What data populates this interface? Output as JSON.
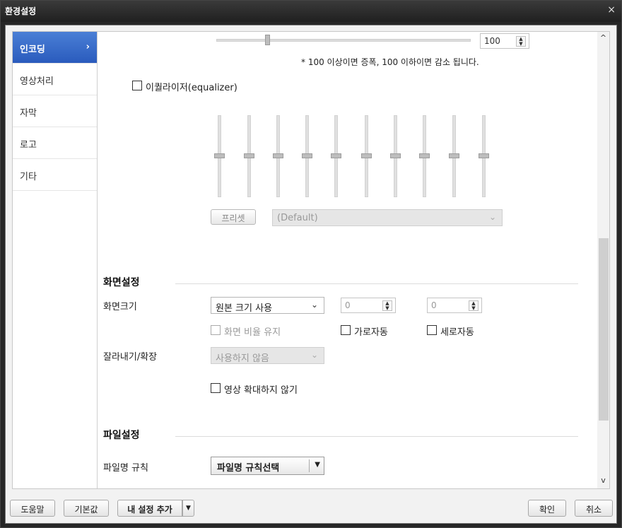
{
  "window": {
    "title": "환경설정",
    "close_icon": "×"
  },
  "sidebar": {
    "items": [
      {
        "label": "인코딩",
        "active": true
      },
      {
        "label": "영상처리"
      },
      {
        "label": "자막"
      },
      {
        "label": "로고"
      },
      {
        "label": "기타"
      }
    ],
    "active_chevron": "›"
  },
  "audio": {
    "volume_value": "100",
    "volume_slider_fraction": 0.2,
    "volume_note": "* 100 이상이면 증폭, 100 이하이면 감소 됩니다.",
    "equalizer_label": "이퀄라이저(equalizer)",
    "equalizer_checked": false,
    "equalizer_bands": 10,
    "preset_button": "프리셋",
    "preset_value": "(Default)"
  },
  "screen": {
    "section_title": "화면설정",
    "size_label": "화면크기",
    "size_value": "원본 크기 사용",
    "width_value": "0",
    "height_value": "0",
    "keep_ratio_label": "화면 비율 유지",
    "auto_width_label": "가로자동",
    "auto_height_label": "세로자동",
    "crop_label": "잘라내기/확장",
    "crop_value": "사용하지 않음",
    "no_upscale_label": "영상 확대하지 않기"
  },
  "file": {
    "section_title": "파일설정",
    "name_rule_label": "파일명 규칙",
    "name_rule_value": "파일명 규칙선택"
  },
  "footer": {
    "help": "도움말",
    "default": "기본값",
    "add_my_settings": "내 설정 추가",
    "ok": "확인",
    "cancel": "취소"
  },
  "icons": {
    "scroll_up": "^",
    "scroll_down": "v",
    "combo_arrow": "⌄",
    "dropdown_arrow": "▼",
    "spin_arrows": "▲▼"
  }
}
